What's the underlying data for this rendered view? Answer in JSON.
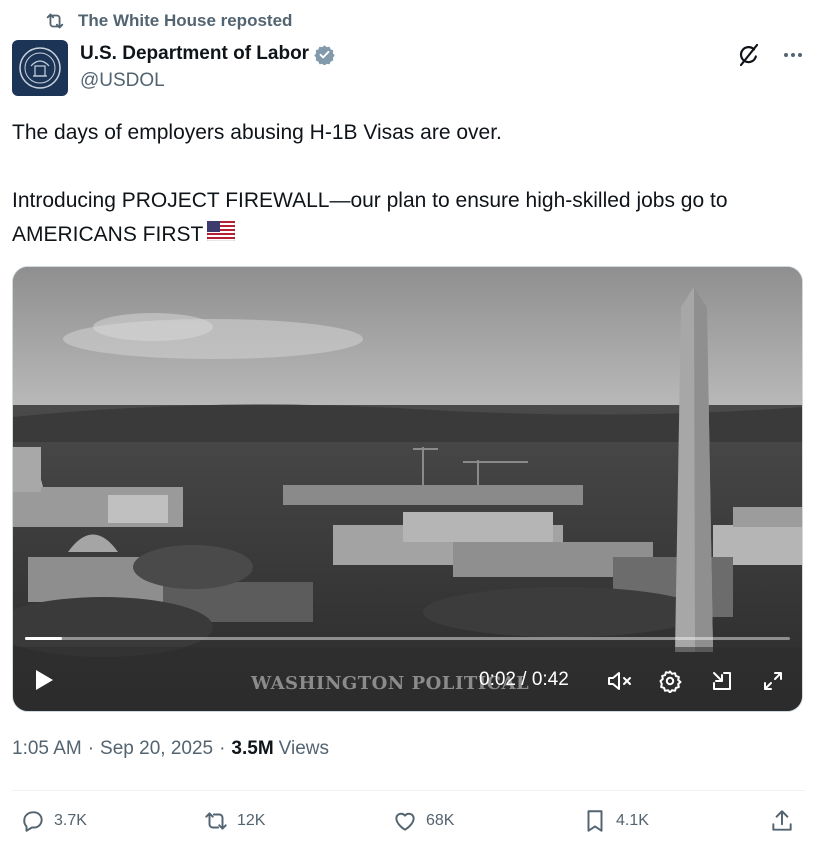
{
  "repost": {
    "text": "The White House reposted",
    "icon": "repost-icon"
  },
  "author": {
    "name": "U.S. Department of Labor",
    "handle": "@USDOL",
    "verified": true,
    "badge_color": "#829aab",
    "avatar_icon": "department-seal-icon"
  },
  "tweet": {
    "text": "The days of employers abusing H-1B Visas are over.\n\nIntroducing PROJECT FIREWALL—our plan to ensure high-skilled jobs go to AMERICANS FIRST",
    "emoji": "us-flag"
  },
  "video": {
    "watermark": "WASHINGTON POLITICAL",
    "current_time": "0:02",
    "duration": "0:42",
    "time_display": "0:02 / 0:42",
    "progress": 0.048,
    "muted": true
  },
  "meta": {
    "time": "1:05 AM",
    "date": "Sep 20, 2025",
    "views_count": "3.5M",
    "views_label": "Views"
  },
  "actions": {
    "replies": "3.7K",
    "reposts": "12K",
    "likes": "68K",
    "bookmarks": "4.1K"
  },
  "colors": {
    "text": "#0f1419",
    "secondary": "#536471",
    "divider": "#eff3f4"
  }
}
